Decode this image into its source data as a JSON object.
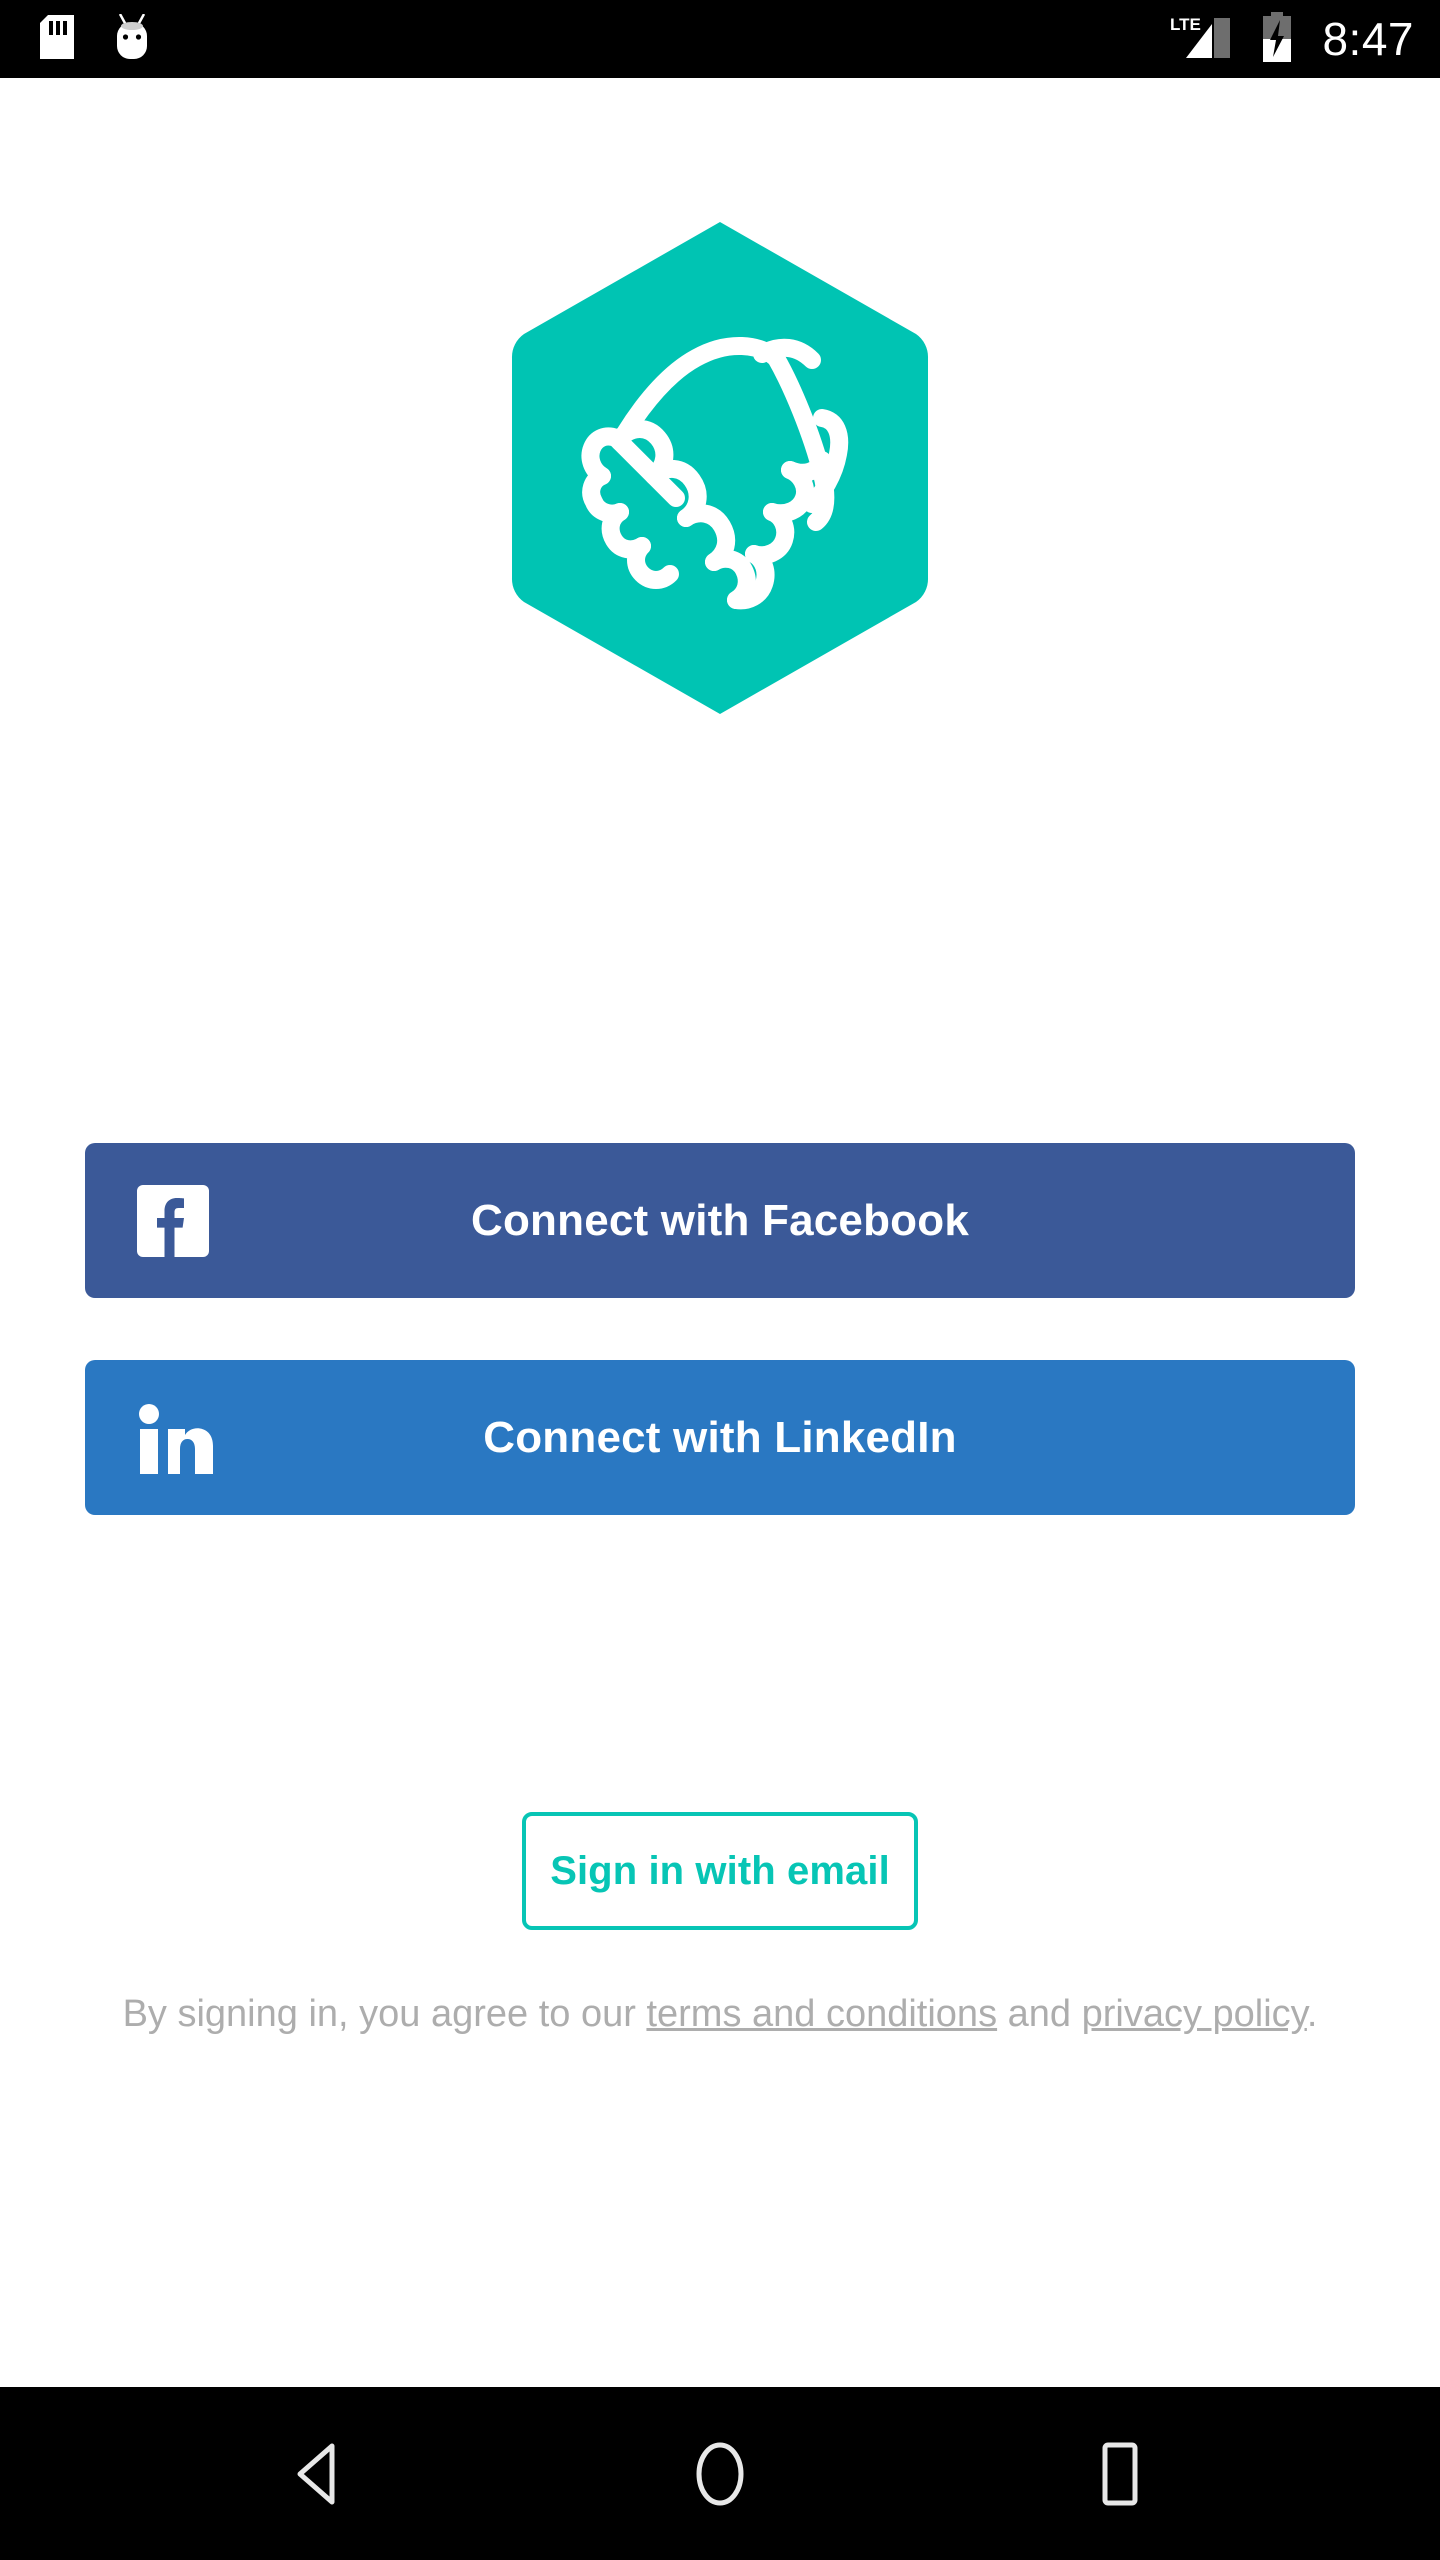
{
  "status_bar": {
    "icons_left": [
      "sd-card-icon",
      "android-debug-icon"
    ],
    "network_label": "LTE",
    "signal_icon": "signal-bars-icon",
    "battery_icon": "battery-charging-icon",
    "clock": "8:47"
  },
  "app": {
    "logo_name": "handshake-hexagon-logo",
    "brand_color": "#00c4b3"
  },
  "auth": {
    "facebook": {
      "label": "Connect with Facebook",
      "icon": "facebook-icon",
      "color": "#3b5998"
    },
    "linkedin": {
      "label": "Connect with LinkedIn",
      "icon": "linkedin-icon",
      "color": "#2a78c2"
    },
    "email": {
      "label": "Sign in with email",
      "color": "#07c5b5"
    }
  },
  "legal": {
    "prefix": "By signing in, you agree to our ",
    "terms_link": "terms and conditions",
    "middle": " and ",
    "privacy_link": "privacy policy",
    "suffix": "."
  },
  "nav_bar": {
    "back": "back-icon",
    "home": "home-icon",
    "recents": "recents-icon"
  }
}
